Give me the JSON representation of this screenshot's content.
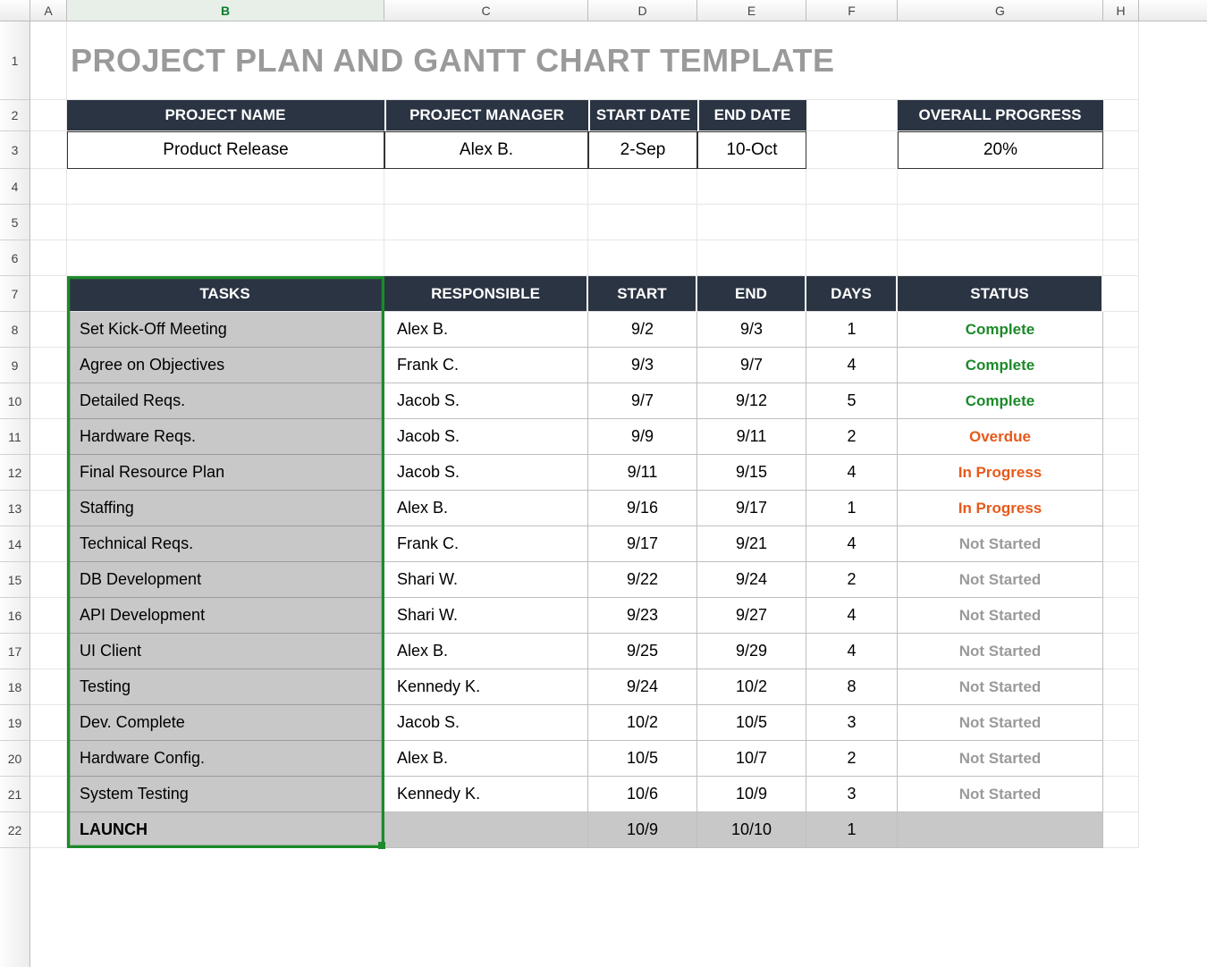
{
  "columns": [
    "A",
    "B",
    "C",
    "D",
    "E",
    "F",
    "G",
    "H"
  ],
  "active_column": "B",
  "row_labels": [
    "1",
    "2",
    "3",
    "4",
    "5",
    "6",
    "7",
    "8",
    "9",
    "10",
    "11",
    "12",
    "13",
    "14",
    "15",
    "16",
    "17",
    "18",
    "19",
    "20",
    "21",
    "22"
  ],
  "title": "PROJECT PLAN AND GANTT CHART TEMPLATE",
  "info_headers": {
    "project_name": "PROJECT NAME",
    "project_manager": "PROJECT MANAGER",
    "start_date": "START DATE",
    "end_date": "END DATE",
    "overall_progress": "OVERALL PROGRESS"
  },
  "info_values": {
    "project_name": "Product Release",
    "project_manager": "Alex B.",
    "start_date": "2-Sep",
    "end_date": "10-Oct",
    "overall_progress": "20%"
  },
  "task_headers": {
    "tasks": "TASKS",
    "responsible": "RESPONSIBLE",
    "start": "START",
    "end": "END",
    "days": "DAYS",
    "status": "STATUS"
  },
  "tasks": [
    {
      "name": "Set Kick-Off Meeting",
      "responsible": "Alex B.",
      "start": "9/2",
      "end": "9/3",
      "days": "1",
      "status": "Complete"
    },
    {
      "name": "Agree on Objectives",
      "responsible": "Frank C.",
      "start": "9/3",
      "end": "9/7",
      "days": "4",
      "status": "Complete"
    },
    {
      "name": "Detailed Reqs.",
      "responsible": "Jacob S.",
      "start": "9/7",
      "end": "9/12",
      "days": "5",
      "status": "Complete"
    },
    {
      "name": "Hardware Reqs.",
      "responsible": "Jacob S.",
      "start": "9/9",
      "end": "9/11",
      "days": "2",
      "status": "Overdue"
    },
    {
      "name": "Final Resource Plan",
      "responsible": "Jacob S.",
      "start": "9/11",
      "end": "9/15",
      "days": "4",
      "status": "In Progress"
    },
    {
      "name": "Staffing",
      "responsible": "Alex B.",
      "start": "9/16",
      "end": "9/17",
      "days": "1",
      "status": "In Progress"
    },
    {
      "name": "Technical Reqs.",
      "responsible": "Frank C.",
      "start": "9/17",
      "end": "9/21",
      "days": "4",
      "status": "Not Started"
    },
    {
      "name": "DB Development",
      "responsible": "Shari W.",
      "start": "9/22",
      "end": "9/24",
      "days": "2",
      "status": "Not Started"
    },
    {
      "name": "API Development",
      "responsible": "Shari W.",
      "start": "9/23",
      "end": "9/27",
      "days": "4",
      "status": "Not Started"
    },
    {
      "name": "UI Client",
      "responsible": "Alex B.",
      "start": "9/25",
      "end": "9/29",
      "days": "4",
      "status": "Not Started"
    },
    {
      "name": "Testing",
      "responsible": "Kennedy K.",
      "start": "9/24",
      "end": "10/2",
      "days": "8",
      "status": "Not Started"
    },
    {
      "name": "Dev. Complete",
      "responsible": "Jacob S.",
      "start": "10/2",
      "end": "10/5",
      "days": "3",
      "status": "Not Started"
    },
    {
      "name": "Hardware Config.",
      "responsible": "Alex B.",
      "start": "10/5",
      "end": "10/7",
      "days": "2",
      "status": "Not Started"
    },
    {
      "name": "System Testing",
      "responsible": "Kennedy K.",
      "start": "10/6",
      "end": "10/9",
      "days": "3",
      "status": "Not Started"
    },
    {
      "name": "LAUNCH",
      "responsible": "",
      "start": "10/9",
      "end": "10/10",
      "days": "1",
      "status": ""
    }
  ],
  "status_colors": {
    "Complete": "#1c8a2a",
    "Overdue": "#e55a1b",
    "In Progress": "#e55a1b",
    "Not Started": "#9a9a9a"
  }
}
